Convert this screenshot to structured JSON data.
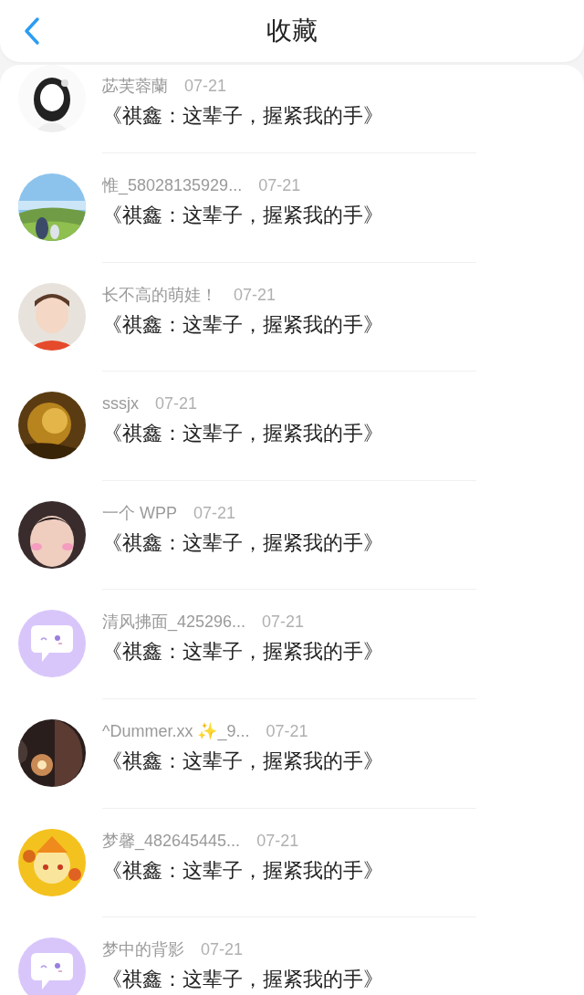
{
  "header": {
    "title": "收藏"
  },
  "items": [
    {
      "name": "苾芙蓉蘭",
      "date": "07-21",
      "title": "《祺鑫：这辈子，握紧我的手》"
    },
    {
      "name": "惟_58028135929...",
      "date": "07-21",
      "title": "《祺鑫：这辈子，握紧我的手》"
    },
    {
      "name": "长不高的萌娃！",
      "date": "07-21",
      "title": "《祺鑫：这辈子，握紧我的手》"
    },
    {
      "name": "sssjx",
      "date": "07-21",
      "title": "《祺鑫：这辈子，握紧我的手》"
    },
    {
      "name": "一个 WPP",
      "date": "07-21",
      "title": "《祺鑫：这辈子，握紧我的手》"
    },
    {
      "name": "清风拂面_425296...",
      "date": "07-21",
      "title": "《祺鑫：这辈子，握紧我的手》",
      "avatar": {
        "kind": "default"
      }
    },
    {
      "name": "^Dummer.xx ✨_9...",
      "date": "07-21",
      "title": "《祺鑫：这辈子，握紧我的手》"
    },
    {
      "name": "梦馨_482645445...",
      "date": "07-21",
      "title": "《祺鑫：这辈子，握紧我的手》"
    },
    {
      "name": "梦中的背影",
      "date": "07-21",
      "title": "《祺鑫：这辈子，握紧我的手》",
      "avatar": {
        "kind": "default"
      }
    }
  ]
}
